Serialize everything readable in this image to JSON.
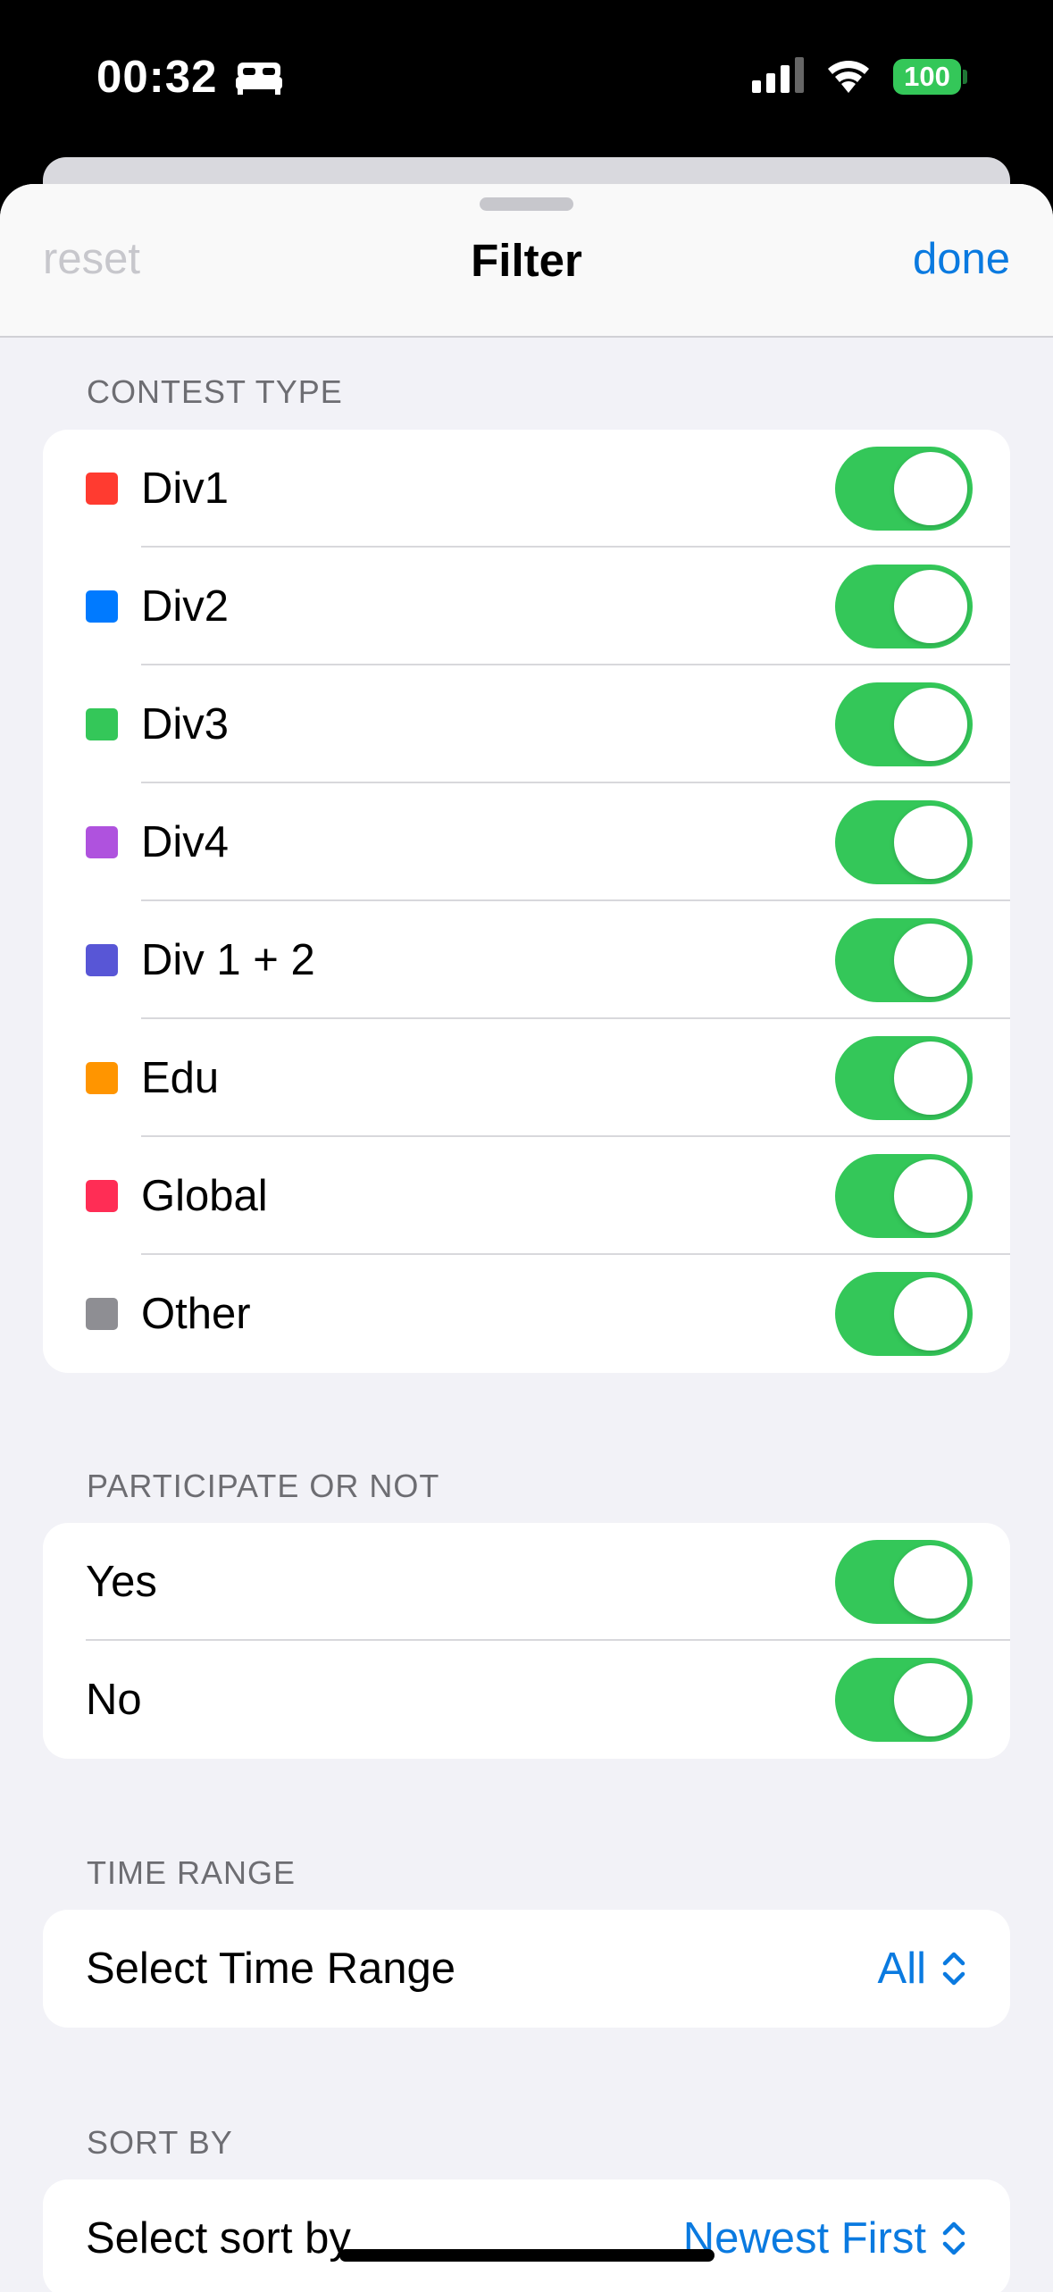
{
  "status": {
    "time": "00:32",
    "battery": "100"
  },
  "nav": {
    "reset_label": "reset",
    "title": "Filter",
    "done_label": "done"
  },
  "sections": {
    "contest_type": {
      "header": "CONTEST TYPE",
      "items": [
        {
          "label": "Div1",
          "color": "#FF3B30"
        },
        {
          "label": "Div2",
          "color": "#007AFF"
        },
        {
          "label": "Div3",
          "color": "#34C759"
        },
        {
          "label": "Div4",
          "color": "#AF52DE"
        },
        {
          "label": "Div 1 + 2",
          "color": "#5856D6"
        },
        {
          "label": "Edu",
          "color": "#FF9500"
        },
        {
          "label": "Global",
          "color": "#FF2D55"
        },
        {
          "label": "Other",
          "color": "#8E8E93"
        }
      ]
    },
    "participate": {
      "header": "PARTICIPATE OR NOT",
      "items": [
        {
          "label": "Yes"
        },
        {
          "label": "No"
        }
      ]
    },
    "time_range": {
      "header": "TIME RANGE",
      "label": "Select Time Range",
      "value": "All"
    },
    "sort_by": {
      "header": "SORT BY",
      "label": "Select sort by",
      "value": "Newest First"
    }
  },
  "colors": {
    "accent": "#0A7AE0",
    "toggle_on": "#34C759"
  }
}
